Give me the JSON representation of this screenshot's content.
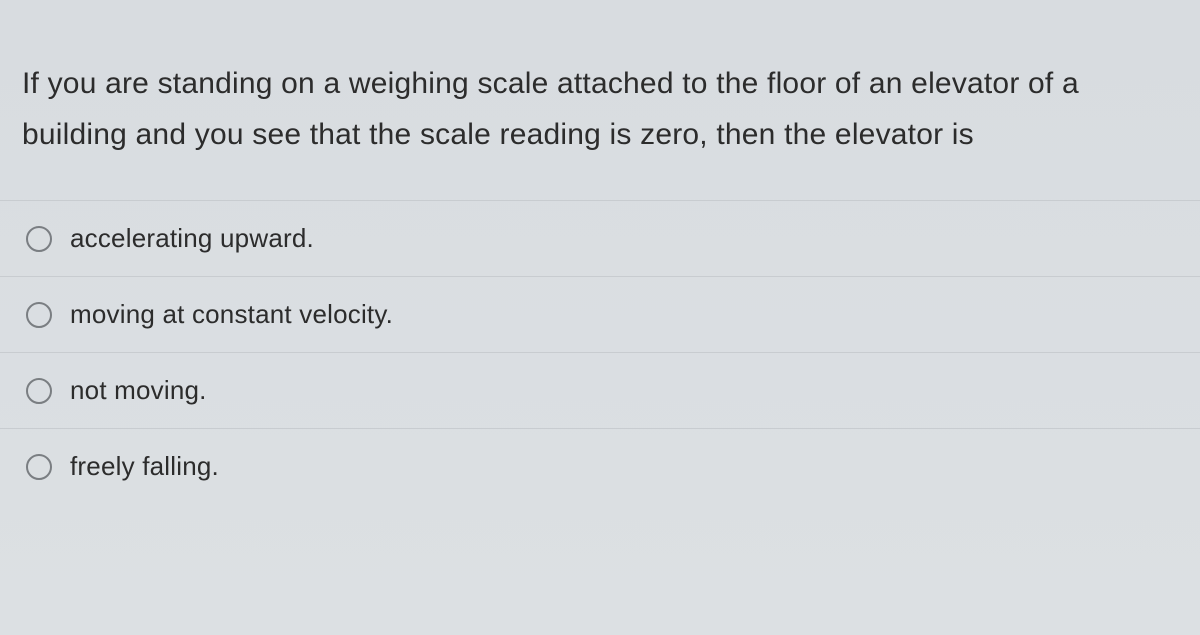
{
  "question": {
    "stem": "If you are standing on a weighing scale attached to the floor of an elevator of a building and you see that the scale reading is zero, then the elevator is",
    "options": [
      {
        "label": "accelerating upward."
      },
      {
        "label": "moving at constant velocity."
      },
      {
        "label": "not moving."
      },
      {
        "label": "freely falling."
      }
    ]
  }
}
